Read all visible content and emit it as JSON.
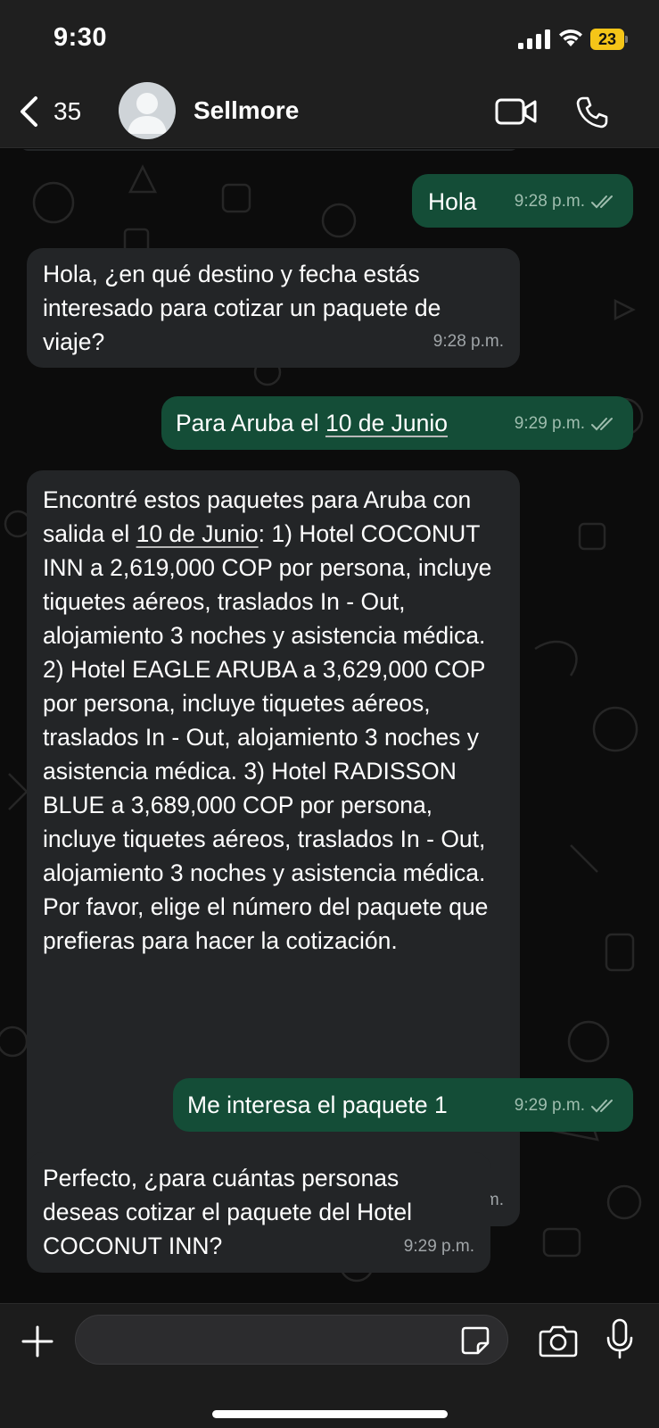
{
  "status_bar": {
    "time": "9:30",
    "battery_level": "23",
    "icons": [
      "signal-icon",
      "wifi-icon",
      "battery-icon"
    ]
  },
  "header": {
    "back_count": "35",
    "contact_name": "Sellmore",
    "icons": [
      "back-chevron-icon",
      "avatar-placeholder-icon",
      "video-call-icon",
      "phone-icon"
    ]
  },
  "messages": [
    {
      "direction": "out",
      "text": "Hola",
      "time": "9:28 p.m.",
      "read": true
    },
    {
      "direction": "in",
      "text": "Hola, ¿en qué destino y fecha estás interesado para cotizar un paquete de viaje?",
      "time": "9:28 p.m."
    },
    {
      "direction": "out",
      "text_before": "Para Aruba el ",
      "link": "10 de Junio",
      "text_after": "",
      "time": "9:29 p.m.",
      "read": true
    },
    {
      "direction": "in",
      "text_before": "Encontré estos paquetes para Aruba con salida el ",
      "link": "10 de Junio",
      "text_after": ": 1) Hotel COCONUT INN a 2,619,000 COP por persona, incluye tiquetes aéreos, traslados In - Out, alojamiento 3 noches y asistencia médica. 2) Hotel EAGLE ARUBA a 3,629,000 COP por persona, incluye tiquetes aéreos, traslados In - Out, alojamiento 3 noches y asistencia médica. 3) Hotel RADISSON BLUE a 3,689,000 COP por persona, incluye tiquetes aéreos, traslados In - Out, alojamiento 3 noches y asistencia médica. Por favor, elige el número del paquete que prefieras para hacer la cotización.",
      "time": "9:29 p.m."
    },
    {
      "direction": "out",
      "text": "Me interesa el paquete 1",
      "time": "9:29 p.m.",
      "read": true
    },
    {
      "direction": "in",
      "text": "Perfecto, ¿para cuántas personas deseas cotizar el paquete del Hotel COCONUT INN?",
      "time": "9:29 p.m."
    }
  ],
  "input_bar": {
    "message_value": "",
    "icons": [
      "plus-icon",
      "sticker-icon",
      "camera-icon",
      "microphone-icon"
    ]
  },
  "colors": {
    "outgoing_bubble": "#144d37",
    "incoming_bubble": "#232527",
    "read_ticks": "#9ebdae",
    "battery": "#f5c518"
  }
}
